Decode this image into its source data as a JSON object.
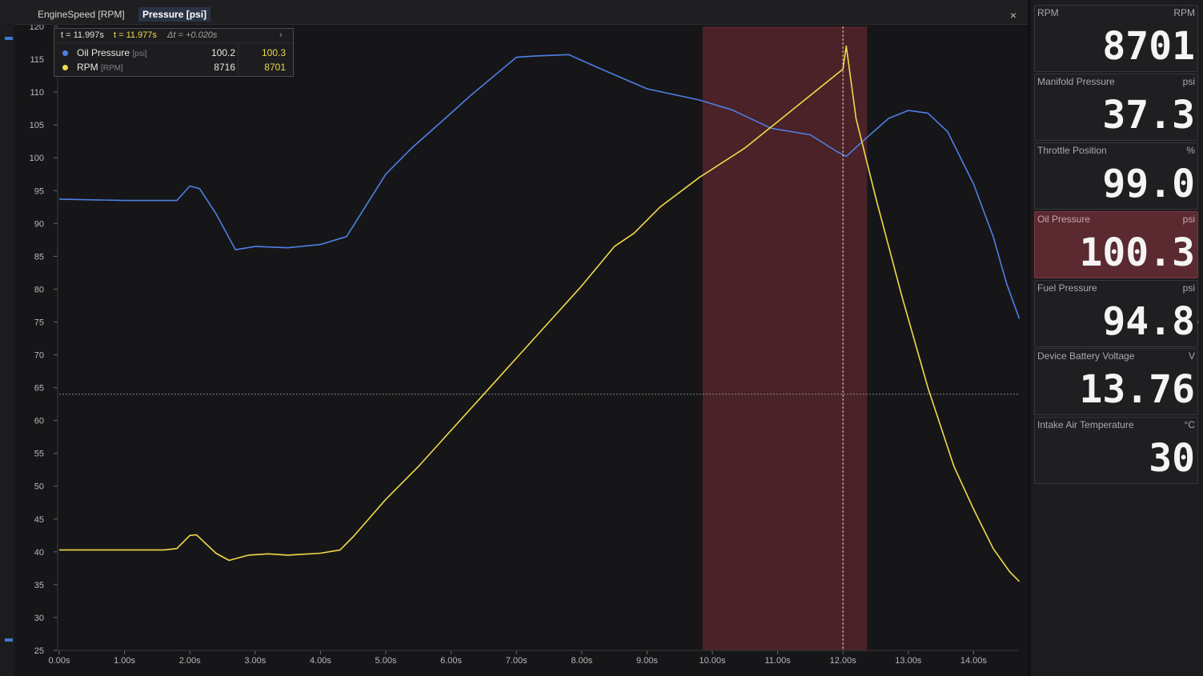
{
  "tabs": [
    {
      "label": "EngineSpeed [RPM]",
      "active": false
    },
    {
      "label": "Pressure [psi]",
      "active": true
    }
  ],
  "close_label": "×",
  "tooltip": {
    "cursor1": "t = 11.997s",
    "cursor2": "t = 11.977s",
    "delta": "Δt = +0.020s",
    "chevron": "›",
    "rows": [
      {
        "name": "Oil Pressure",
        "unit": "[psi]",
        "value1": "100.2",
        "value2": "100.3",
        "color": "#4f7fe6"
      },
      {
        "name": "RPM",
        "unit": "[RPM]",
        "value1": "8716",
        "value2": "8701",
        "color": "#f1d94a"
      }
    ]
  },
  "colors": {
    "oil": "#4f7fe6",
    "rpm": "#f1d94a",
    "highlight": "#4a2227",
    "grid": "#2c2c30",
    "axis_text": "#b8b8bc"
  },
  "chart_data": {
    "type": "line",
    "x_unit": "s",
    "xlim": [
      0,
      14.7
    ],
    "ylim": [
      25,
      120
    ],
    "x_ticks": [
      "0.00s",
      "1.00s",
      "2.00s",
      "3.00s",
      "4.00s",
      "5.00s",
      "6.00s",
      "7.00s",
      "8.00s",
      "9.00s",
      "10.00s",
      "11.00s",
      "12.00s",
      "13.00s",
      "14.00s"
    ],
    "y_ticks": [
      25,
      30,
      35,
      40,
      45,
      50,
      55,
      60,
      65,
      70,
      75,
      80,
      85,
      90,
      95,
      100,
      105,
      110,
      115,
      120
    ],
    "highlight_region": [
      9.85,
      12.37
    ],
    "cursor_x": 12.0,
    "reference_y": 64,
    "series": [
      {
        "name": "Oil Pressure",
        "color": "#4f7fe6",
        "x": [
          0,
          1,
          1.8,
          2.0,
          2.15,
          2.4,
          2.7,
          3.0,
          3.5,
          4.0,
          4.4,
          5.0,
          5.4,
          6.0,
          6.3,
          7.0,
          7.3,
          7.8,
          8.3,
          9.0,
          9.8,
          10.3,
          10.9,
          11.5,
          11.9,
          12.05,
          12.3,
          12.7,
          13.0,
          13.3,
          13.6,
          14.0,
          14.3,
          14.5,
          14.7
        ],
        "values": [
          93.7,
          93.5,
          93.5,
          95.7,
          95.3,
          91.5,
          86.0,
          86.5,
          86.3,
          86.8,
          88.0,
          97.5,
          101.5,
          106.8,
          109.5,
          115.3,
          115.5,
          115.7,
          113.5,
          110.5,
          108.8,
          107.3,
          104.5,
          103.5,
          101.0,
          100.2,
          102.5,
          106.0,
          107.2,
          106.8,
          104.0,
          96.0,
          88.0,
          81.0,
          75.5
        ]
      },
      {
        "name": "RPM",
        "color": "#f1d94a",
        "x": [
          0,
          1.6,
          1.8,
          2.0,
          2.1,
          2.4,
          2.6,
          2.9,
          3.2,
          3.5,
          4.0,
          4.3,
          4.5,
          5.0,
          5.5,
          6.0,
          6.5,
          7.0,
          7.5,
          8.0,
          8.5,
          8.8,
          9.2,
          9.8,
          10.5,
          11.0,
          11.5,
          12.0,
          12.05,
          12.2,
          12.5,
          12.9,
          13.3,
          13.7,
          14.0,
          14.3,
          14.55,
          14.7
        ],
        "values": [
          40.3,
          40.3,
          40.5,
          42.5,
          42.6,
          39.8,
          38.7,
          39.5,
          39.7,
          39.5,
          39.8,
          40.3,
          42.3,
          48.0,
          53.0,
          58.5,
          64.0,
          69.5,
          75.0,
          80.5,
          86.5,
          88.5,
          92.5,
          97.0,
          101.5,
          105.5,
          109.5,
          113.5,
          117.0,
          106.0,
          94.0,
          79.0,
          65.0,
          53.0,
          46.5,
          40.5,
          37.0,
          35.5
        ]
      }
    ]
  },
  "gauges": [
    {
      "label": "RPM",
      "unit": "RPM",
      "value": "8701",
      "alert": false
    },
    {
      "label": "Manifold Pressure",
      "unit": "psi",
      "value": "37.3",
      "alert": false
    },
    {
      "label": "Throttle Position",
      "unit": "%",
      "value": "99.0",
      "alert": false
    },
    {
      "label": "Oil Pressure",
      "unit": "psi",
      "value": "100.3",
      "alert": true
    },
    {
      "label": "Fuel Pressure",
      "unit": "psi",
      "value": "94.8",
      "alert": false
    },
    {
      "label": "Device Battery Voltage",
      "unit": "V",
      "value": "13.76",
      "alert": false
    },
    {
      "label": "Intake Air Temperature",
      "unit": "°C",
      "value": "30",
      "alert": false
    }
  ]
}
